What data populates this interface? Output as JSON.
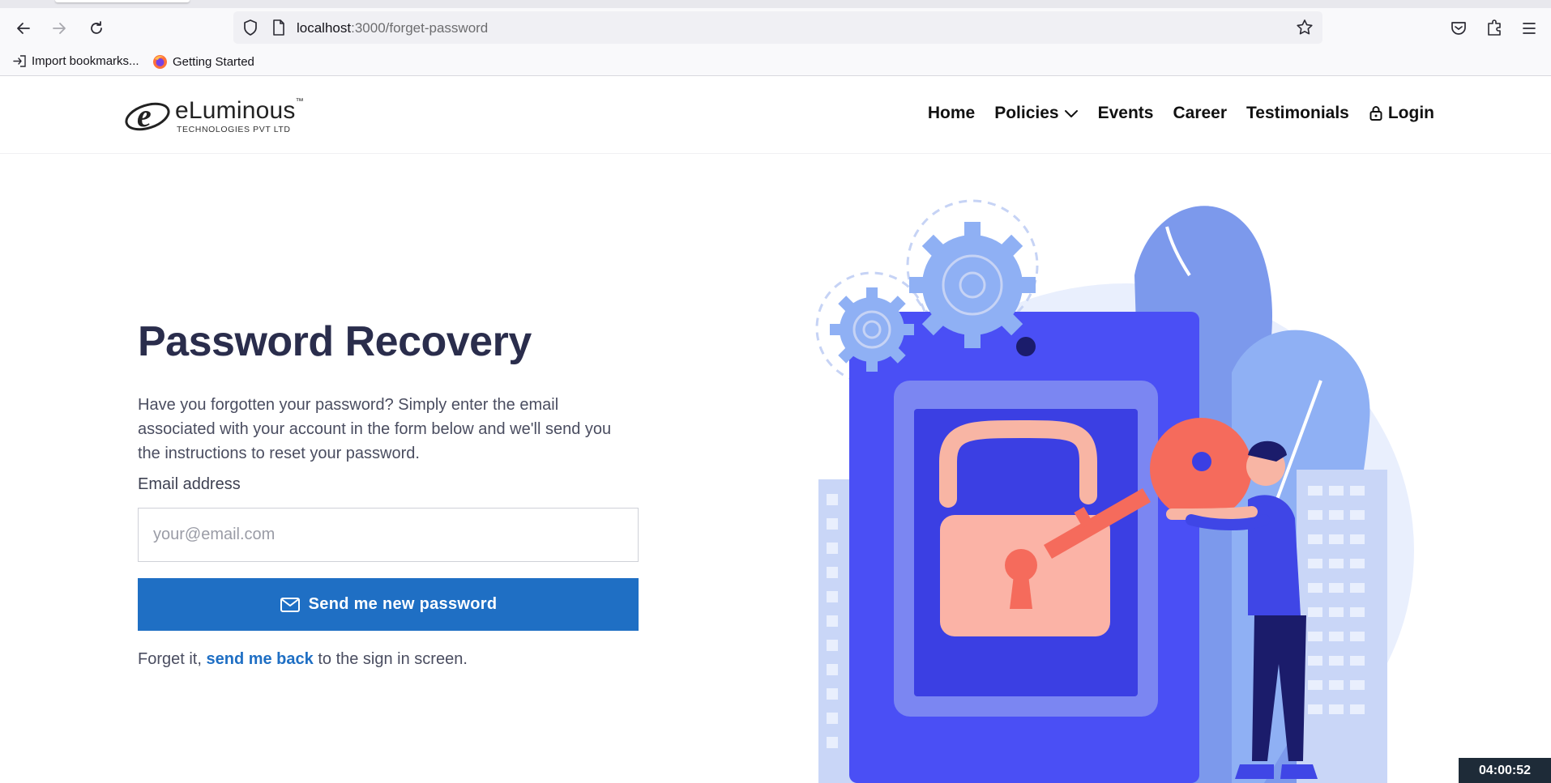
{
  "browser": {
    "url_host": "localhost",
    "url_path": ":3000/forget-password",
    "bookmarks": [
      {
        "label": "Import bookmarks...",
        "icon": "import-icon"
      },
      {
        "label": "Getting Started",
        "icon": "firefox-icon"
      }
    ]
  },
  "site": {
    "logo": {
      "brand": "eLuminous",
      "trademark": "™",
      "tagline": "TECHNOLOGIES PVT LTD"
    },
    "menu": {
      "home": "Home",
      "policies": "Policies",
      "events": "Events",
      "career": "Career",
      "testimonials": "Testimonials",
      "login": "Login"
    }
  },
  "form": {
    "title": "Password Recovery",
    "description": "Have you forgotten your password? Simply enter the email associated with your account in the form below and we'll send you the instructions to reset your password.",
    "email_label": "Email address",
    "email_placeholder": "your@email.com",
    "email_value": "",
    "submit_label": "Send me new password",
    "back_prefix": "Forget it, ",
    "back_link": "send me back",
    "back_suffix": " to the sign in screen."
  },
  "timer": "04:00:52",
  "colors": {
    "accent": "#1f6fc4",
    "title": "#2a2d4c",
    "illustration_primary": "#4a4ff5",
    "illustration_key": "#f56b5c"
  }
}
